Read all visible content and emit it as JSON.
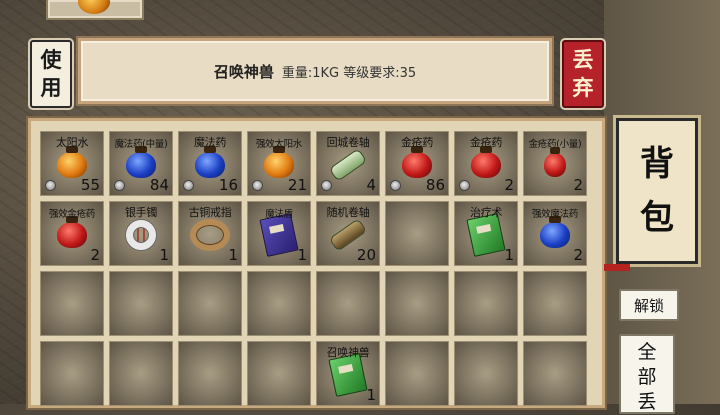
{
  "buttons": {
    "use": [
      "使",
      "用"
    ],
    "drop": [
      "丢",
      "弃"
    ],
    "unlock": "解锁",
    "all": [
      "全",
      "部",
      "丢"
    ]
  },
  "bag_title": [
    "背",
    "包"
  ],
  "selected_item": {
    "name": "召唤神兽",
    "meta": "重量:1KG 等级要求:35"
  },
  "inventory": [
    {
      "label": "太阳水",
      "count": "55",
      "icon": "orange-potion-icon",
      "locked": true
    },
    {
      "label": "魔法药(中量)",
      "count": "84",
      "icon": "blue-potion-icon",
      "locked": true,
      "small_label": true
    },
    {
      "label": "魔法药",
      "count": "16",
      "icon": "blue-potion-icon",
      "locked": true
    },
    {
      "label": "强效太阳水",
      "count": "21",
      "icon": "orange-potion-icon",
      "locked": true,
      "small_label": true
    },
    {
      "label": "回城卷轴",
      "count": "4",
      "icon": "scroll-icon",
      "locked": true
    },
    {
      "label": "金疮药",
      "count": "86",
      "icon": "red-potion-icon",
      "locked": true
    },
    {
      "label": "金疮药",
      "count": "2",
      "icon": "red-potion-icon",
      "locked": true
    },
    {
      "label": "金疮药(小量)",
      "count": "2",
      "icon": "small-red-potion-icon",
      "locked": false,
      "small_label": true
    },
    {
      "label": "强效金疮药",
      "count": "2",
      "icon": "red-potion-icon",
      "locked": false,
      "small_label": true
    },
    {
      "label": "银手镯",
      "count": "1",
      "icon": "bracelet-icon",
      "locked": false
    },
    {
      "label": "古铜戒指",
      "count": "1",
      "icon": "ring-icon",
      "locked": false
    },
    {
      "label": "魔法盾",
      "count": "1",
      "icon": "purple-book-icon",
      "locked": false,
      "small_label": true,
      "label_display": "魔法盾"
    },
    {
      "label": "随机卷轴",
      "count": "20",
      "icon": "dark-scroll-icon",
      "locked": false
    },
    {
      "label": "",
      "count": "",
      "icon": "",
      "locked": false
    },
    {
      "label": "治疗术",
      "count": "1",
      "icon": "green-book-icon",
      "locked": false
    },
    {
      "label": "强效魔法药",
      "count": "2",
      "icon": "blue-potion-icon",
      "locked": false,
      "small_label": true
    },
    {
      "label": "",
      "count": "",
      "icon": "",
      "locked": false
    },
    {
      "label": "",
      "count": "",
      "icon": "",
      "locked": false
    },
    {
      "label": "",
      "count": "",
      "icon": "",
      "locked": false
    },
    {
      "label": "",
      "count": "",
      "icon": "",
      "locked": false
    },
    {
      "label": "",
      "count": "",
      "icon": "",
      "locked": false
    },
    {
      "label": "",
      "count": "",
      "icon": "",
      "locked": false
    },
    {
      "label": "",
      "count": "",
      "icon": "",
      "locked": false
    },
    {
      "label": "",
      "count": "",
      "icon": "",
      "locked": false
    },
    {
      "label": "",
      "count": "",
      "icon": "",
      "locked": false
    },
    {
      "label": "",
      "count": "",
      "icon": "",
      "locked": false
    },
    {
      "label": "",
      "count": "",
      "icon": "",
      "locked": false
    },
    {
      "label": "",
      "count": "",
      "icon": "",
      "locked": false
    },
    {
      "label": "召唤神兽",
      "count": "1",
      "icon": "green-book-icon",
      "locked": false
    },
    {
      "label": "",
      "count": "",
      "icon": "",
      "locked": false
    },
    {
      "label": "",
      "count": "",
      "icon": "",
      "locked": false
    },
    {
      "label": "",
      "count": "",
      "icon": "",
      "locked": false
    }
  ]
}
